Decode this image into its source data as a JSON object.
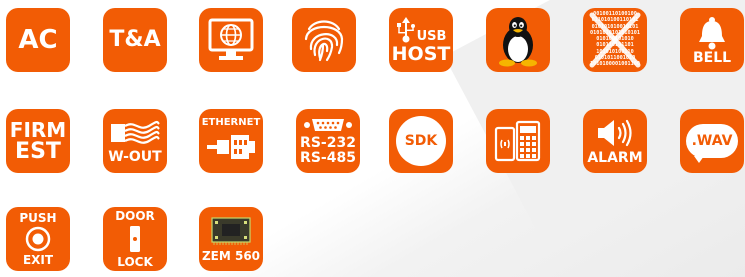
{
  "tiles": {
    "ac": {
      "label": "AC"
    },
    "ta": {
      "label": "T&A"
    },
    "webserver": {
      "icon": "globe-monitor-icon"
    },
    "fingerprint": {
      "icon": "fingerprint-icon"
    },
    "usbhost": {
      "line1": "USB",
      "line2": "HOST"
    },
    "linux": {
      "icon": "linux-penguin-icon"
    },
    "binary": {
      "rows": [
        "00100110100100",
        "011010100110101",
        "010101010010101",
        "0101010101010101",
        "010100101010",
        "010110101101",
        "101010100110",
        "0101011001010",
        "1010100001001100"
      ]
    },
    "bell": {
      "label": "BELL"
    },
    "firmtest": {
      "line1": "FIRM",
      "line2": "EST"
    },
    "wout": {
      "label": "W-OUT"
    },
    "ethernet": {
      "label": "ETHERNET"
    },
    "rs": {
      "line1": "RS-232",
      "line2": "RS-485"
    },
    "sdk": {
      "label": "SDK"
    },
    "cardreader": {
      "icon": "card-keypad-icon"
    },
    "alarm": {
      "label": "ALARM"
    },
    "wav": {
      "label": ".WAV"
    },
    "pushexit": {
      "line1": "PUSH",
      "line2": "EXIT"
    },
    "doorlock": {
      "line1": "DOOR",
      "line2": "LOCK"
    },
    "zem": {
      "label": "ZEM 560"
    }
  },
  "colors": {
    "tile": "#f25c05",
    "background": "#ffffff",
    "icon": "#ffffff"
  }
}
